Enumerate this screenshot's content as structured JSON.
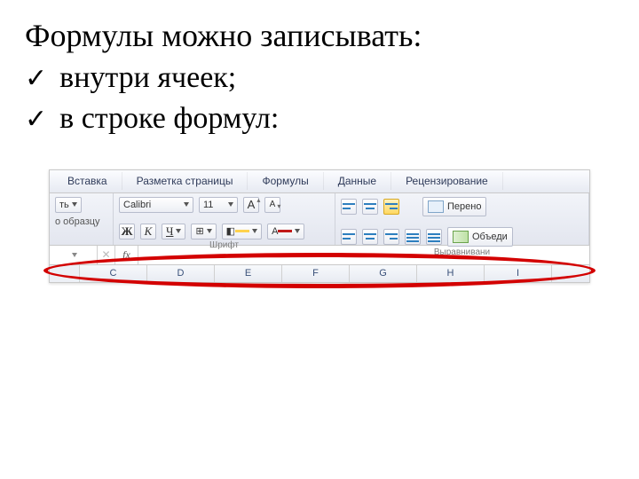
{
  "title": "Формулы можно записывать:",
  "bullets": [
    {
      "text": "внутри ячеек;"
    },
    {
      "text": "в строке формул:"
    }
  ],
  "checkmark": "✓",
  "excel": {
    "tabs": [
      "Вставка",
      "Разметка страницы",
      "Формулы",
      "Данные",
      "Рецензирование"
    ],
    "clipboard": {
      "paste_drop": "ть",
      "format_painter": "о образцу"
    },
    "font_group": {
      "label": "Шрифт",
      "font_name": "Calibri",
      "font_size": "11",
      "grow": "A",
      "shrink": "A",
      "bold": "Ж",
      "italic": "К",
      "underline": "Ч",
      "border_icon": "⊞",
      "fill_icon": "◧",
      "fontcolor_icon": "A"
    },
    "align_group": {
      "label": "Выравнивани",
      "wrap_label": "Перено",
      "merge_label": "Объеди"
    },
    "fx_label": "fx",
    "columns": [
      "",
      "C",
      "D",
      "E",
      "F",
      "G",
      "H",
      "I"
    ]
  }
}
